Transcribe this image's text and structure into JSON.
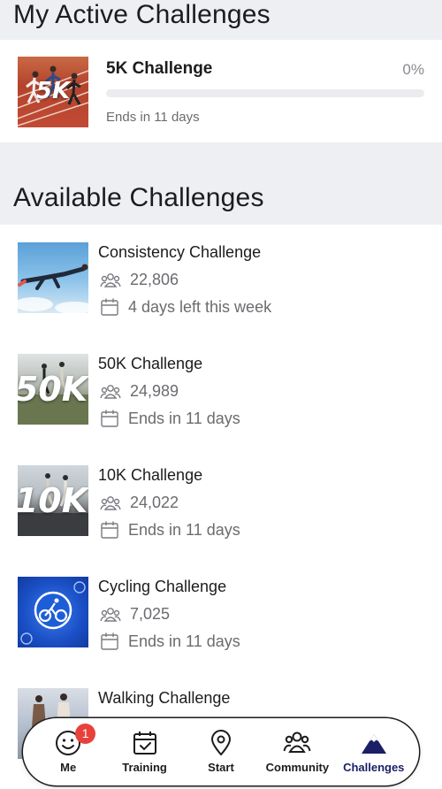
{
  "active_section": {
    "title": "My Active Challenges",
    "challenge": {
      "name": "5K Challenge",
      "thumb_label": "5K",
      "progress_percent_text": "0%",
      "progress_fraction": 0,
      "ends": "Ends in 11 days"
    }
  },
  "available_section": {
    "title": "Available Challenges",
    "items": [
      {
        "name": "Consistency Challenge",
        "participants": "22,806",
        "date_text": "4 days left this week",
        "thumb_label": ""
      },
      {
        "name": "50K Challenge",
        "participants": "24,989",
        "date_text": "Ends in 11 days",
        "thumb_label": "50K"
      },
      {
        "name": "10K Challenge",
        "participants": "24,022",
        "date_text": "Ends in 11 days",
        "thumb_label": "10K"
      },
      {
        "name": "Cycling Challenge",
        "participants": "7,025",
        "date_text": "Ends in 11 days",
        "thumb_label": ""
      },
      {
        "name": "Walking Challenge",
        "participants": "",
        "date_text": "",
        "thumb_label": ""
      }
    ]
  },
  "nav": {
    "items": [
      {
        "label": "Me",
        "icon": "smiley-icon",
        "badge": "1"
      },
      {
        "label": "Training",
        "icon": "calendar-check-icon"
      },
      {
        "label": "Start",
        "icon": "location-pin-icon"
      },
      {
        "label": "Community",
        "icon": "people-icon"
      },
      {
        "label": "Challenges",
        "icon": "mountain-icon",
        "active": true
      }
    ]
  },
  "colors": {
    "accent": "#1a1f66",
    "badge": "#e8413b",
    "background": "#eeeff3"
  }
}
